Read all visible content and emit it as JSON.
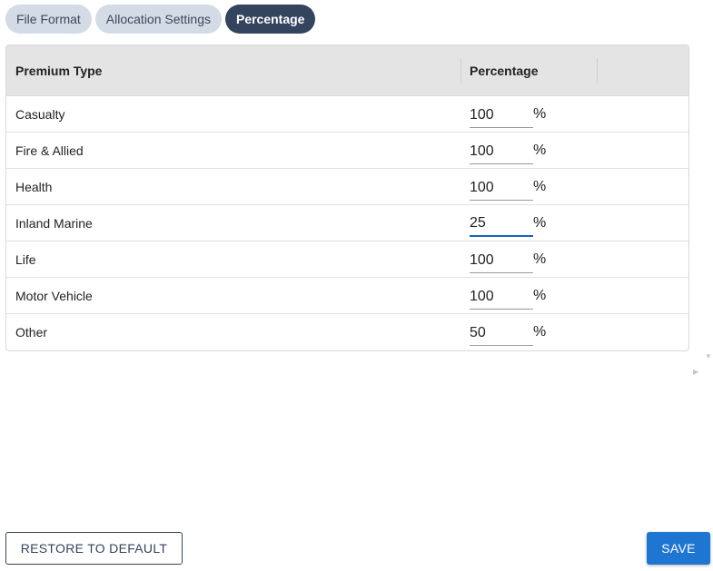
{
  "tabs": [
    {
      "label": "File Format",
      "active": false
    },
    {
      "label": "Allocation Settings",
      "active": false
    },
    {
      "label": "Percentage",
      "active": true
    }
  ],
  "grid": {
    "columns": {
      "type": "Premium Type",
      "percentage": "Percentage"
    },
    "rows": [
      {
        "type": "Casualty",
        "value": "100"
      },
      {
        "type": "Fire & Allied",
        "value": "100"
      },
      {
        "type": "Health",
        "value": "100"
      },
      {
        "type": "Inland Marine",
        "value": "25"
      },
      {
        "type": "Life",
        "value": "100"
      },
      {
        "type": "Motor Vehicle",
        "value": "100"
      },
      {
        "type": "Other",
        "value": "50"
      }
    ],
    "unit": "%"
  },
  "actions": {
    "restore_label": "RESTORE TO DEFAULT",
    "save_label": "SAVE"
  },
  "icons": {
    "scroll_down": "triangle-down-icon",
    "scroll_right": "triangle-right-icon"
  },
  "colors": {
    "accent": "#1f76d2",
    "tab_active": "#34435e",
    "tab_inactive": "#d3dbe6",
    "header_bg": "#e4e4e4"
  }
}
